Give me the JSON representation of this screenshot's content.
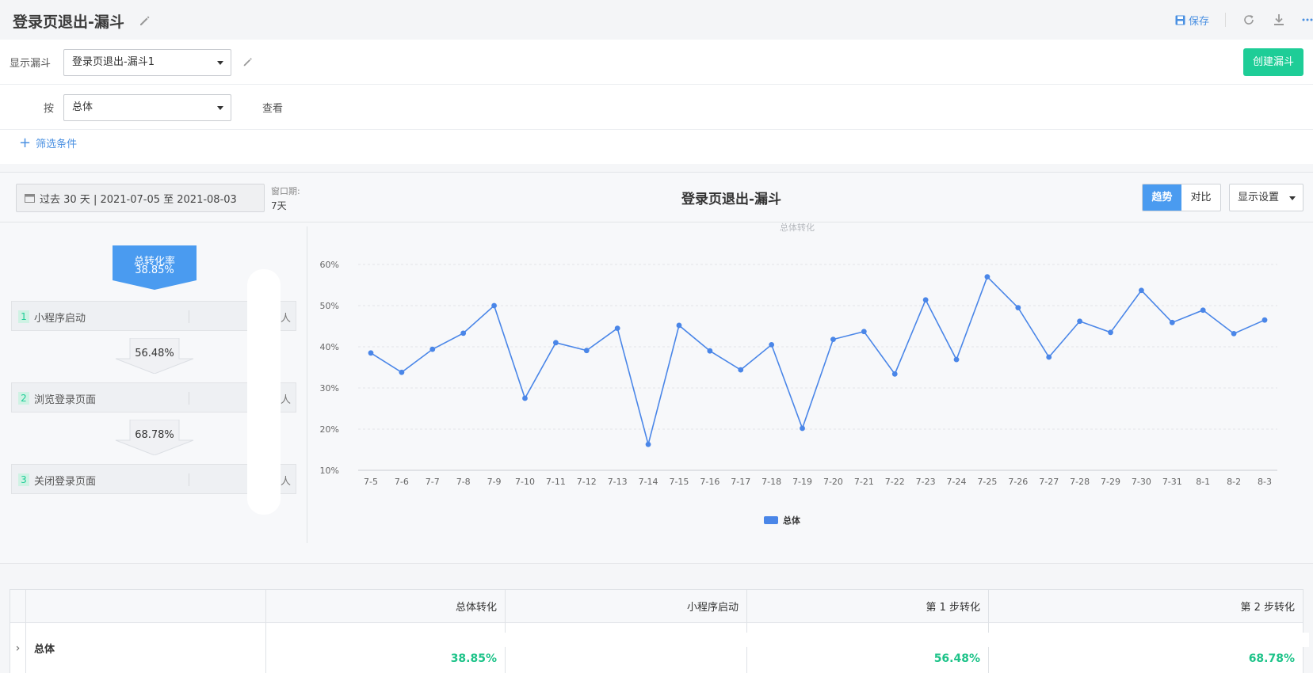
{
  "header": {
    "title": "登录页退出-漏斗",
    "save_label": "保存"
  },
  "filters": {
    "funnel_label": "显示漏斗",
    "funnel_value": "登录页退出-漏斗1",
    "by_label": "按",
    "by_value": "总体",
    "view_label": "查看",
    "add_filter_label": "筛选条件",
    "create_label": "创建漏斗"
  },
  "toolbar": {
    "date_range": "过去 30 天 | 2021-07-05 至 2021-08-03",
    "window_label": "窗口期:",
    "window_value": "7天",
    "chart_title": "登录页退出-漏斗",
    "trend_label": "趋势",
    "compare_label": "对比",
    "display_settings_label": "显示设置"
  },
  "funnel": {
    "total_label": "总转化率",
    "total_value": "38.85%",
    "steps": [
      {
        "num": "1",
        "label": "小程序启动",
        "unit": "人"
      },
      {
        "num": "2",
        "label": "浏览登录页面",
        "unit": "人"
      },
      {
        "num": "3",
        "label": "关闭登录页面",
        "unit": "人"
      }
    ],
    "rates": [
      "56.48%",
      "68.78%"
    ]
  },
  "chart_data": {
    "type": "line",
    "title": "总体转化",
    "categories": [
      "7-5",
      "7-6",
      "7-7",
      "7-8",
      "7-9",
      "7-10",
      "7-11",
      "7-12",
      "7-13",
      "7-14",
      "7-15",
      "7-16",
      "7-17",
      "7-18",
      "7-19",
      "7-20",
      "7-21",
      "7-22",
      "7-23",
      "7-24",
      "7-25",
      "7-26",
      "7-27",
      "7-28",
      "7-29",
      "7-30",
      "7-31",
      "8-1",
      "8-2",
      "8-3"
    ],
    "series": [
      {
        "name": "总体",
        "values": [
          38.5,
          33.8,
          39.4,
          43.3,
          50.0,
          27.5,
          41.0,
          39.1,
          44.5,
          16.3,
          45.2,
          39.0,
          34.4,
          40.5,
          20.2,
          41.8,
          43.7,
          33.4,
          51.4,
          36.9,
          57.0,
          49.5,
          37.5,
          46.2,
          43.5,
          53.7,
          45.9,
          48.9,
          43.2,
          46.5
        ]
      }
    ],
    "ylim": [
      10,
      60
    ],
    "yticks": [
      "10%",
      "20%",
      "30%",
      "40%",
      "50%",
      "60%"
    ],
    "color": "#4a86e8",
    "grid": true,
    "legend": "bottom-center"
  },
  "table": {
    "headers": [
      "总体转化",
      "小程序启动",
      "第 1 步转化",
      "第 2 步转化"
    ],
    "rows": [
      {
        "name": "总体",
        "values": [
          "38.85%",
          "",
          "56.48%",
          "68.78%"
        ]
      }
    ]
  }
}
